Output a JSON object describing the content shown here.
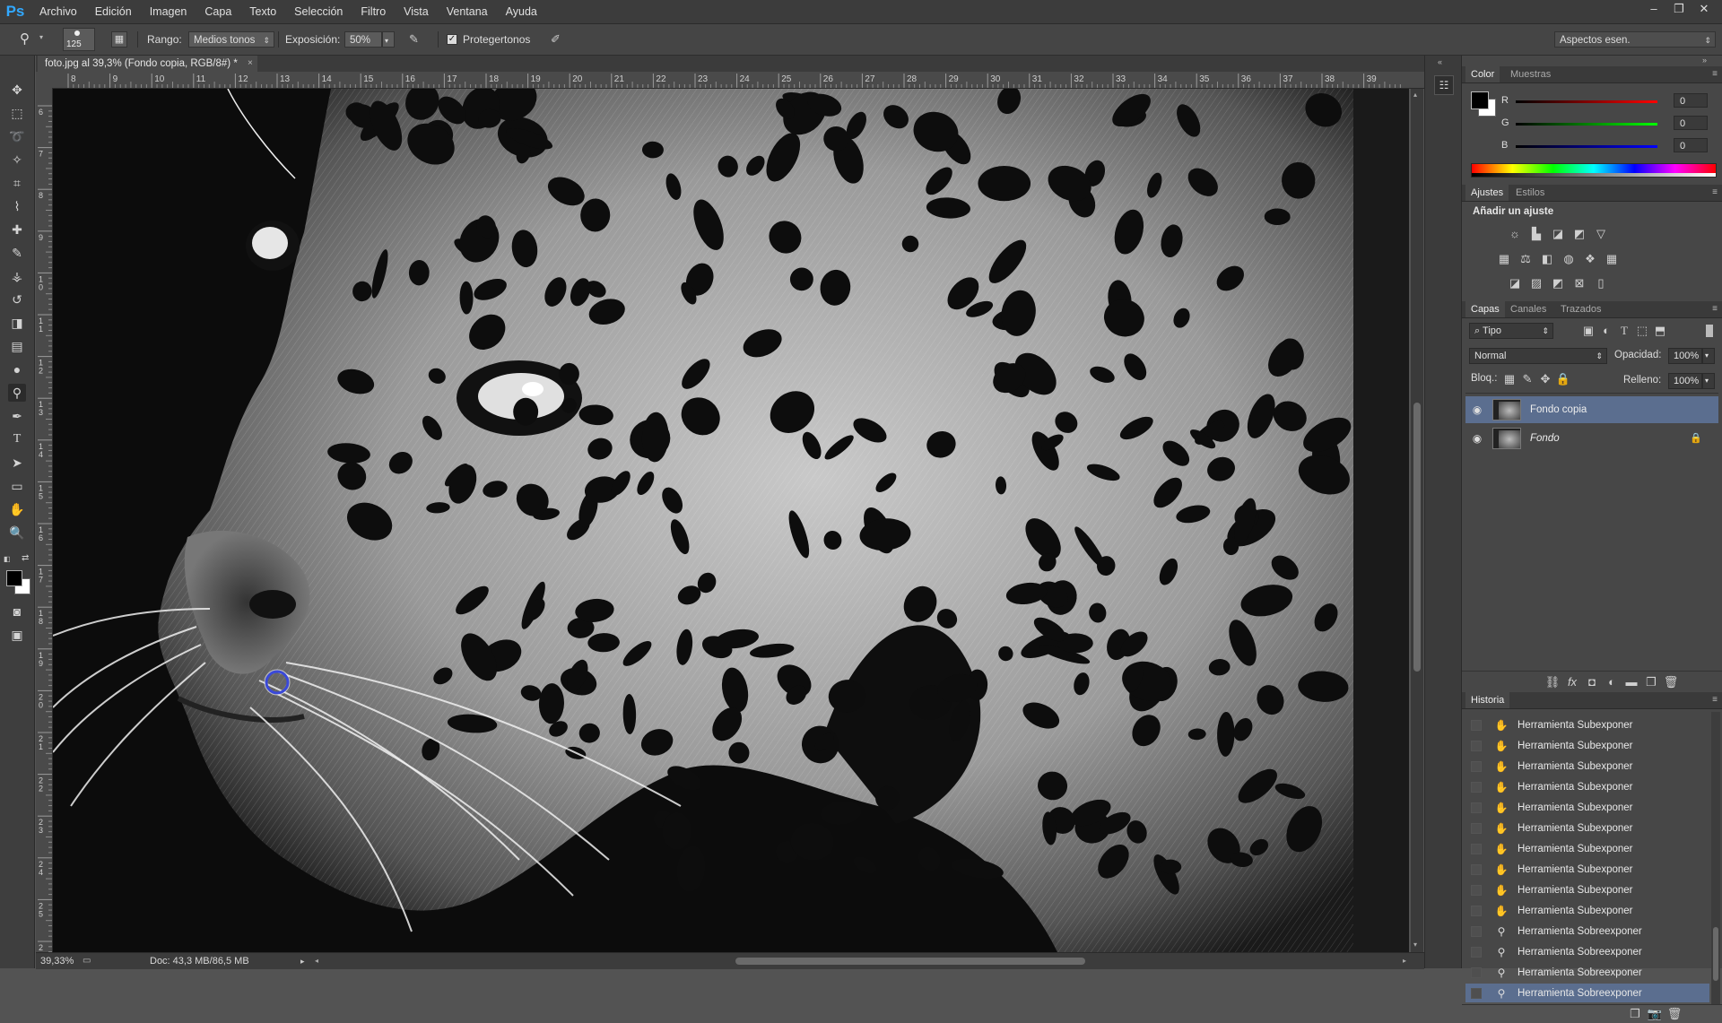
{
  "app": {
    "logo": "Ps"
  },
  "menu": [
    "Archivo",
    "Edición",
    "Imagen",
    "Capa",
    "Texto",
    "Selección",
    "Filtro",
    "Vista",
    "Ventana",
    "Ayuda"
  ],
  "options": {
    "brush_size": "125",
    "range_label": "Rango:",
    "range_value": "Medios tonos",
    "exposure_label": "Exposición:",
    "exposure_value": "50%",
    "protect_tones_label": "Protegertonos",
    "protect_tones_checked": true,
    "workspace": "Aspectos esen."
  },
  "document": {
    "tab_title": "foto.jpg al 39,3% (Fondo copia, RGB/8#) *",
    "tab_close": "×"
  },
  "rulers": {
    "top": [
      "8",
      "9",
      "10",
      "11",
      "12",
      "13",
      "14",
      "15",
      "16",
      "17",
      "18",
      "19",
      "20",
      "21",
      "22",
      "23",
      "24",
      "25",
      "26",
      "27",
      "28",
      "29",
      "30",
      "31",
      "32",
      "33",
      "34",
      "35",
      "36",
      "37",
      "38",
      "39"
    ],
    "left": [
      "6",
      "7",
      "8",
      "9",
      "1 0",
      "1 1",
      "1 2",
      "1 3",
      "1 4",
      "1 5",
      "1 6",
      "1 7",
      "1 8",
      "1 9",
      "2 0",
      "2 1",
      "2 2",
      "2 3",
      "2 4",
      "2 5",
      "2 6"
    ]
  },
  "status": {
    "zoom": "39,33%",
    "doc": "Doc: 43,3 MB/86,5 MB"
  },
  "color_panel": {
    "tabs": [
      "Color",
      "Muestras"
    ],
    "r_label": "R",
    "g_label": "G",
    "b_label": "B",
    "r": "0",
    "g": "0",
    "b": "0",
    "foreground": "#000000",
    "background": "#ffffff"
  },
  "adjust_panel": {
    "tabs": [
      "Ajustes",
      "Estilos"
    ],
    "heading": "Añadir un ajuste"
  },
  "layers_panel": {
    "tabs": [
      "Capas",
      "Canales",
      "Trazados"
    ],
    "filter": "Tipo",
    "blend_mode": "Normal",
    "opacity_label": "Opacidad:",
    "opacity": "100%",
    "lock_label": "Bloq.:",
    "fill_label": "Relleno:",
    "fill": "100%",
    "layers": [
      {
        "name": "Fondo copia",
        "active": true
      },
      {
        "name": "Fondo",
        "active": false
      }
    ]
  },
  "history_panel": {
    "tab": "Historia",
    "items": [
      {
        "name": "Herramienta Subexponer",
        "icon": "burn-icon"
      },
      {
        "name": "Herramienta Subexponer",
        "icon": "burn-icon"
      },
      {
        "name": "Herramienta Subexponer",
        "icon": "burn-icon"
      },
      {
        "name": "Herramienta Subexponer",
        "icon": "burn-icon"
      },
      {
        "name": "Herramienta Subexponer",
        "icon": "burn-icon"
      },
      {
        "name": "Herramienta Subexponer",
        "icon": "burn-icon"
      },
      {
        "name": "Herramienta Subexponer",
        "icon": "burn-icon"
      },
      {
        "name": "Herramienta Subexponer",
        "icon": "burn-icon"
      },
      {
        "name": "Herramienta Subexponer",
        "icon": "burn-icon"
      },
      {
        "name": "Herramienta Subexponer",
        "icon": "burn-icon"
      },
      {
        "name": "Herramienta Sobreexponer",
        "icon": "dodge-icon"
      },
      {
        "name": "Herramienta Sobreexponer",
        "icon": "dodge-icon"
      },
      {
        "name": "Herramienta Sobreexponer",
        "icon": "dodge-icon"
      },
      {
        "name": "Herramienta Sobreexponer",
        "icon": "dodge-icon",
        "active": true
      }
    ]
  }
}
